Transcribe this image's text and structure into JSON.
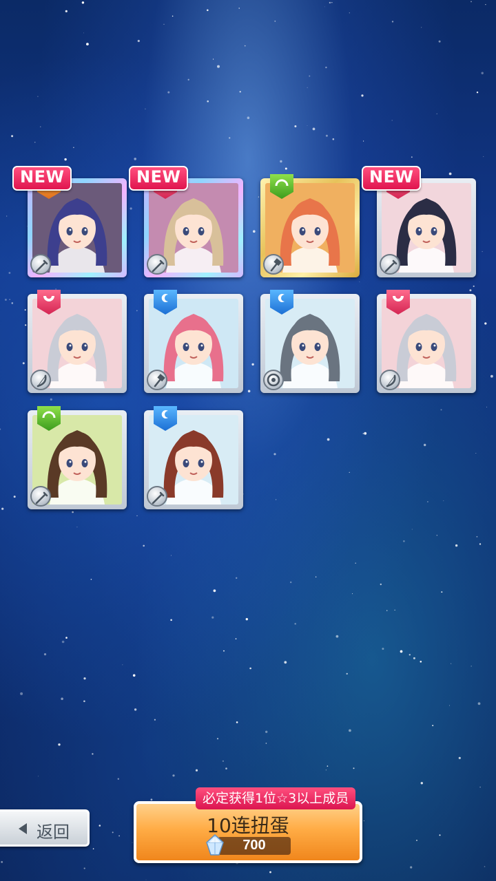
{
  "cards": [
    {
      "new": true,
      "new_label": "NEW",
      "attr": "orange",
      "frame": "rare",
      "weapon": "sword-icon",
      "hair": "#3d3f8e",
      "bg": "#6b5a7a"
    },
    {
      "new": true,
      "new_label": "NEW",
      "attr": "red",
      "frame": "rare",
      "weapon": "sword-icon",
      "hair": "#d8c09a",
      "bg": "#c48bb0"
    },
    {
      "new": false,
      "new_label": "",
      "attr": "green",
      "frame": "gold",
      "weapon": "hammer-icon",
      "hair": "#e8754a",
      "bg": "#f0b060"
    },
    {
      "new": true,
      "new_label": "NEW",
      "attr": "red",
      "frame": "silver",
      "weapon": "sword-icon",
      "hair": "#2b2d45",
      "bg": "#f2d6dc"
    },
    {
      "new": false,
      "new_label": "",
      "attr": "red",
      "frame": "silver",
      "weapon": "bow-icon",
      "hair": "#c9ccd6",
      "bg": "#f3d3d8"
    },
    {
      "new": false,
      "new_label": "",
      "attr": "blue",
      "frame": "silver",
      "weapon": "hammer-icon",
      "hair": "#e8708c",
      "bg": "#cfe8f5"
    },
    {
      "new": false,
      "new_label": "",
      "attr": "blue",
      "frame": "silver",
      "weapon": "shield-icon",
      "hair": "#6a7480",
      "bg": "#d8ecf5"
    },
    {
      "new": false,
      "new_label": "",
      "attr": "red",
      "frame": "silver",
      "weapon": "bow-icon",
      "hair": "#c9ccd6",
      "bg": "#f3d3d8"
    },
    {
      "new": false,
      "new_label": "",
      "attr": "green",
      "frame": "silver",
      "weapon": "sword-icon",
      "hair": "#5a3a26",
      "bg": "#d8e8a8"
    },
    {
      "new": false,
      "new_label": "",
      "attr": "blue",
      "frame": "silver",
      "weapon": "sword-icon",
      "hair": "#8a3a2a",
      "bg": "#d8ecf5"
    }
  ],
  "back_button": {
    "label": "返回"
  },
  "gacha": {
    "title": "10连扭蛋",
    "cost": "700",
    "guarantee": "必定获得1位☆3以上成员"
  },
  "colors": {
    "accent": "#e0154f",
    "button_orange": "#ffac45"
  }
}
